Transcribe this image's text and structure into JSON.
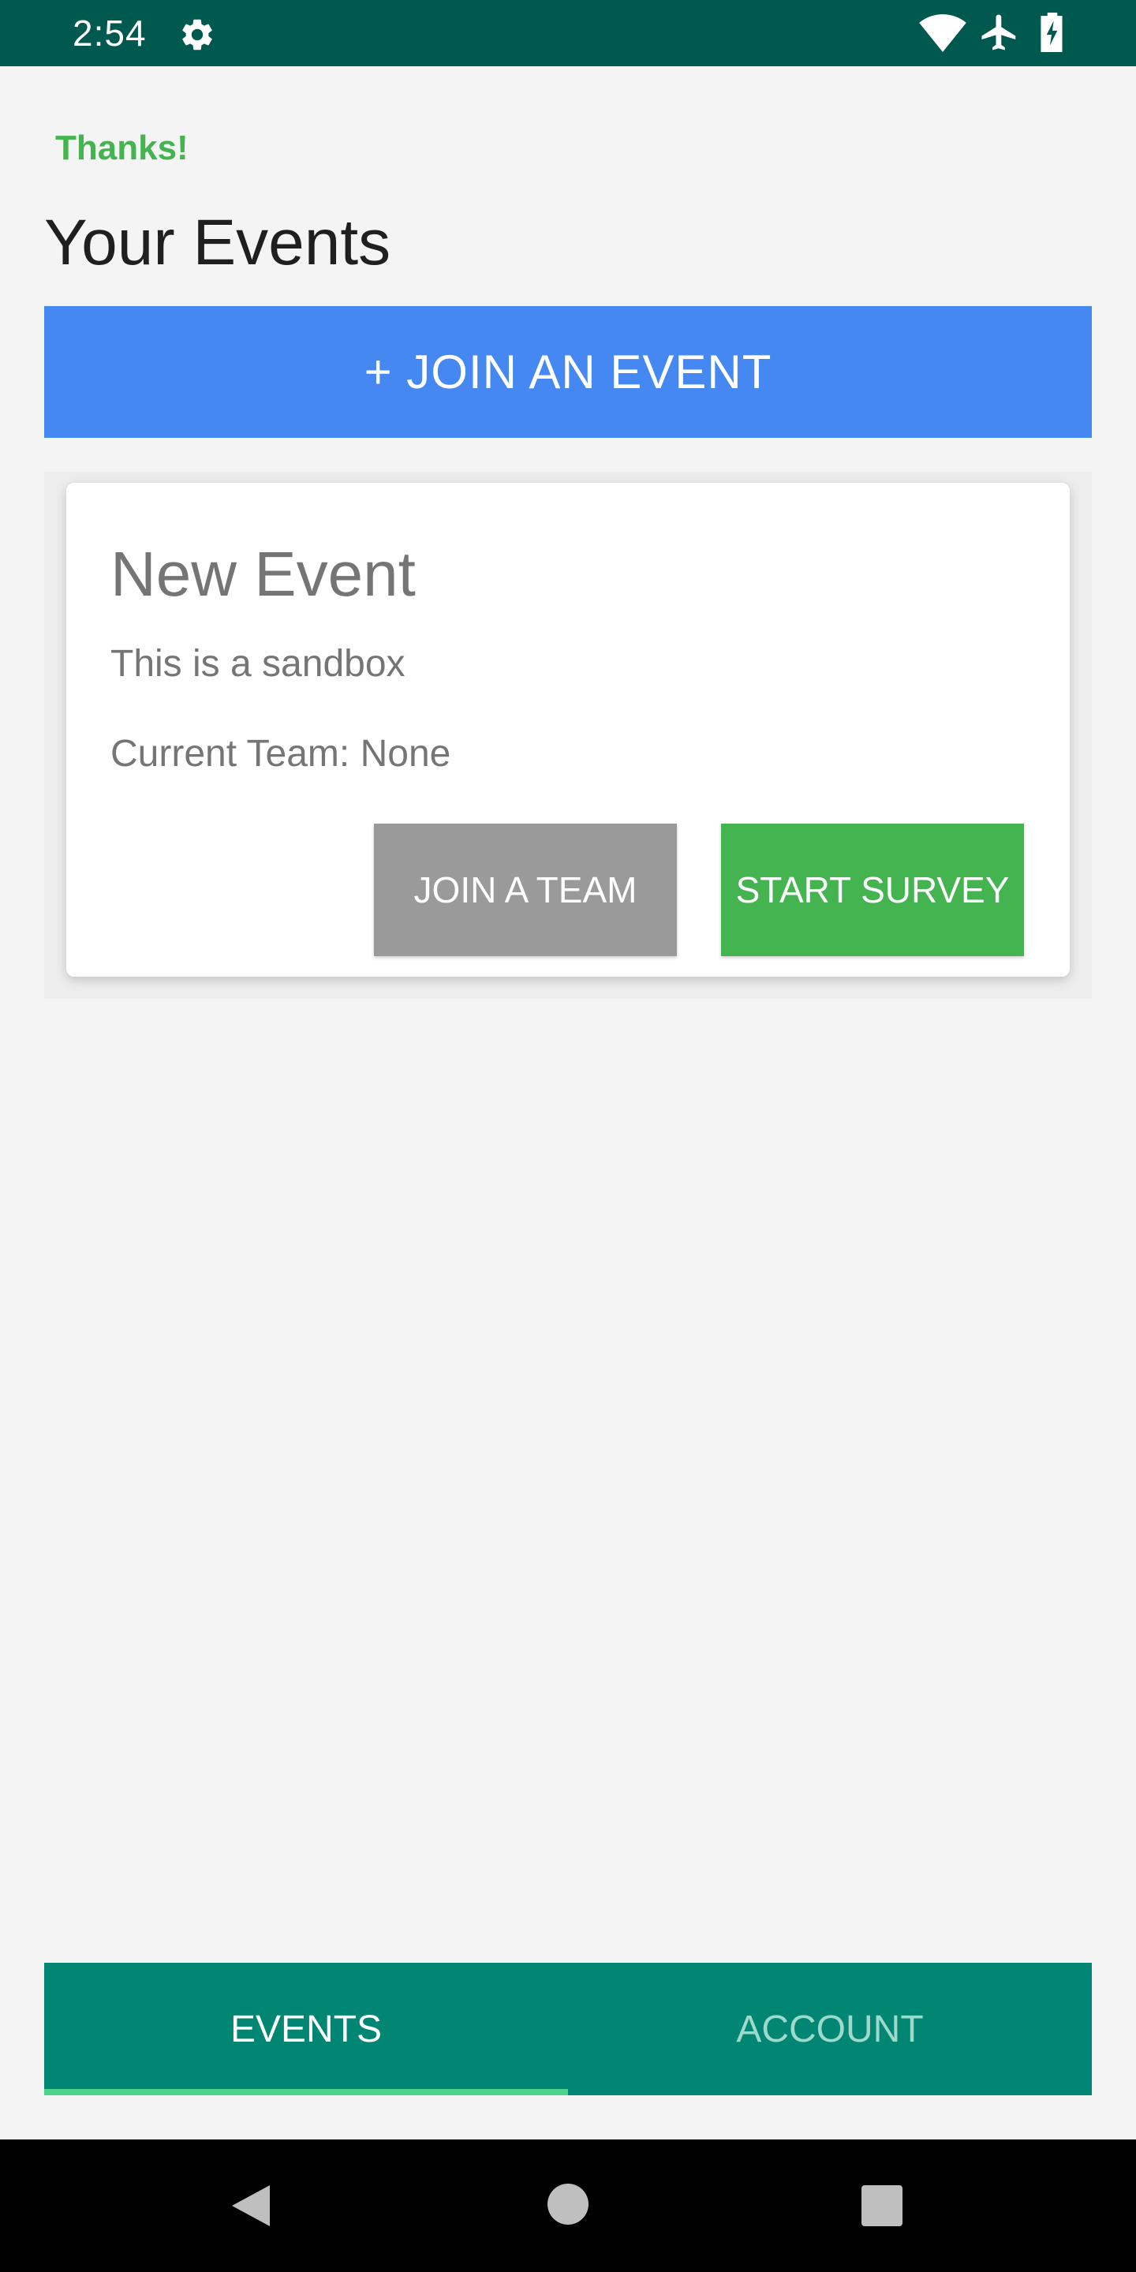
{
  "status_bar": {
    "time": "2:54",
    "icons": [
      "gear-icon",
      "wifi-icon",
      "airplane-icon",
      "battery-icon"
    ]
  },
  "header": {
    "thanks": "Thanks!",
    "title": "Your Events"
  },
  "join_event_button": {
    "label": "+ JOIN AN EVENT"
  },
  "events": [
    {
      "name": "New Event",
      "description": "This is a sandbox",
      "team_label": "Current Team:",
      "team_value": "None",
      "join_team_label": "JOIN A TEAM",
      "start_survey_label": "START SURVEY"
    }
  ],
  "tabs": [
    {
      "label": "EVENTS",
      "selected": true
    },
    {
      "label": "ACCOUNT",
      "selected": false
    }
  ],
  "nav_bar": {
    "icons": [
      "back-icon",
      "home-icon",
      "recents-icon"
    ]
  },
  "colors": {
    "status_bar": "#00594f",
    "accent_green": "#43b450",
    "join_event_blue": "#4588f1",
    "join_team_gray": "#9a9a9a",
    "tab_bar_teal": "#008672",
    "tab_indicator": "#4fd38a",
    "tab_inactive_text": "#9fd9cc"
  }
}
